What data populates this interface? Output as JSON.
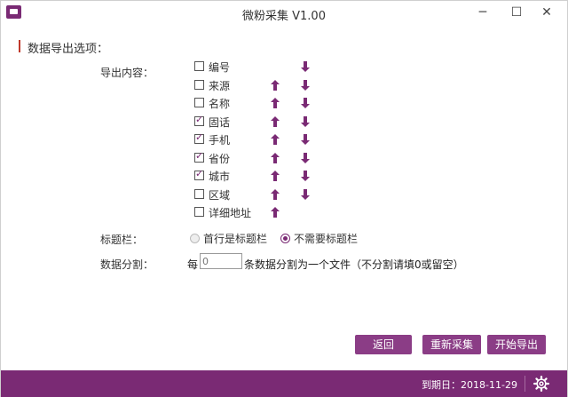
{
  "window": {
    "title": "微粉采集 V1.00",
    "controls": {
      "minimize": "─",
      "maximize": "☐",
      "close": "✕"
    }
  },
  "section": {
    "title": "数据导出选项："
  },
  "export_content": {
    "label": "导出内容：",
    "fields": [
      {
        "label": "编号",
        "checked": false,
        "up": false,
        "down": true
      },
      {
        "label": "来源",
        "checked": false,
        "up": true,
        "down": true
      },
      {
        "label": "名称",
        "checked": false,
        "up": true,
        "down": true
      },
      {
        "label": "固话",
        "checked": true,
        "up": true,
        "down": true
      },
      {
        "label": "手机",
        "checked": true,
        "up": true,
        "down": true
      },
      {
        "label": "省份",
        "checked": true,
        "up": true,
        "down": true
      },
      {
        "label": "城市",
        "checked": true,
        "up": true,
        "down": true
      },
      {
        "label": "区域",
        "checked": false,
        "up": true,
        "down": true
      },
      {
        "label": "详细地址",
        "checked": false,
        "up": true,
        "down": false
      }
    ]
  },
  "title_row": {
    "label": "标题栏：",
    "options": [
      {
        "label": "首行是标题栏",
        "selected": false
      },
      {
        "label": "不需要标题栏",
        "selected": true
      }
    ]
  },
  "split": {
    "label": "数据分割：",
    "prefix": "每",
    "value": "",
    "placeholder": "0",
    "suffix": "条数据分割为一个文件（不分割请填0或留空）"
  },
  "buttons": {
    "back": "返回",
    "recollect": "重新采集",
    "export": "开始导出"
  },
  "status": {
    "expiry": "到期日：2018-11-29"
  },
  "colors": {
    "accent": "#7a2a74",
    "button": "#8b3d86",
    "section_bar": "#c0392b"
  }
}
